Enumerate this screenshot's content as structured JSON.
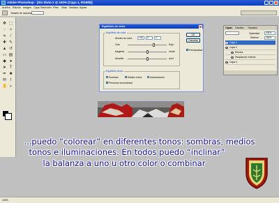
{
  "window": {
    "title": "Adobe Photoshop - [Sin título-1 @ 100% (Capa 1, RGB/8)]"
  },
  "menu": [
    "Archivo",
    "Edición",
    "Imagen",
    "Capa",
    "Selección",
    "Filtro",
    "Vista",
    "Ventana",
    "Ayuda"
  ],
  "options_bar": {
    "label": "Tamaño de muestra:"
  },
  "dialog": {
    "title": "Equilibrio de color",
    "balance_group_title": "Equilibrio de color",
    "levels_label": "Niveles de color:",
    "levels": [
      "+43",
      "0",
      "0"
    ],
    "slider1_left": "Cian",
    "slider1_right": "Rojo",
    "slider2_left": "Magenta",
    "slider2_right": "Verde",
    "slider3_left": "Amarillo",
    "slider3_right": "Azul",
    "tone_group_title": "Equilibrio tonal",
    "tone_options": [
      "Sombras",
      "Medios tonos",
      "Iluminaciones"
    ],
    "tone_selected": 1,
    "preserve_label": "Preservar luminosidad",
    "ok_label": "OK",
    "cancel_label": "Cancelar",
    "preview_label": "Previsualizar"
  },
  "layers_panel": {
    "tabs": [
      "Capas",
      "Canales",
      "Trazados"
    ],
    "opacity_label": "Opacidad:",
    "opacity_value": "100%",
    "fill_label": "Relleno:",
    "fill_value": "100%",
    "rows": [
      "Capa 1",
      "Capa 2",
      "Efectos",
      "Resplandor exterior",
      "Capa 4"
    ],
    "selected_row": 0
  },
  "caption": {
    "line1": "...puedo “colorear” en diferentes tonos: sombras, medios",
    "line2": "tonos e iluminaciones. En todos puedo “inclinar”",
    "line3": "la balanza a uno u otro color o combinar"
  },
  "statusbar": {
    "zoom": "100%"
  },
  "colors": {
    "caption": "#0a0a96",
    "workspace": "#c0c0c0",
    "titlebar": "#0a3fbf"
  }
}
